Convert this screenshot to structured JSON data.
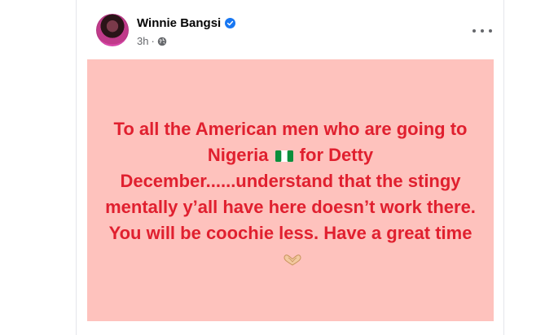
{
  "post": {
    "author_name": "Winnie Bangsi",
    "time": "3h",
    "separator": "·",
    "text_before_flag": "To all the American men who are going to Nigeria ",
    "text_after_flag": " for Detty December......understand that the stingy mentally y’all have here doesn’t work there. You will be coochie less. Have a great time",
    "background_color": "#fec2bd",
    "text_color": "#e0202f"
  },
  "icons": {
    "verified": "verified-badge-icon",
    "audience": "globe-icon",
    "more": "more-options-icon",
    "flag": "nigeria-flag-emoji",
    "heart": "heart-hands-emoji"
  }
}
